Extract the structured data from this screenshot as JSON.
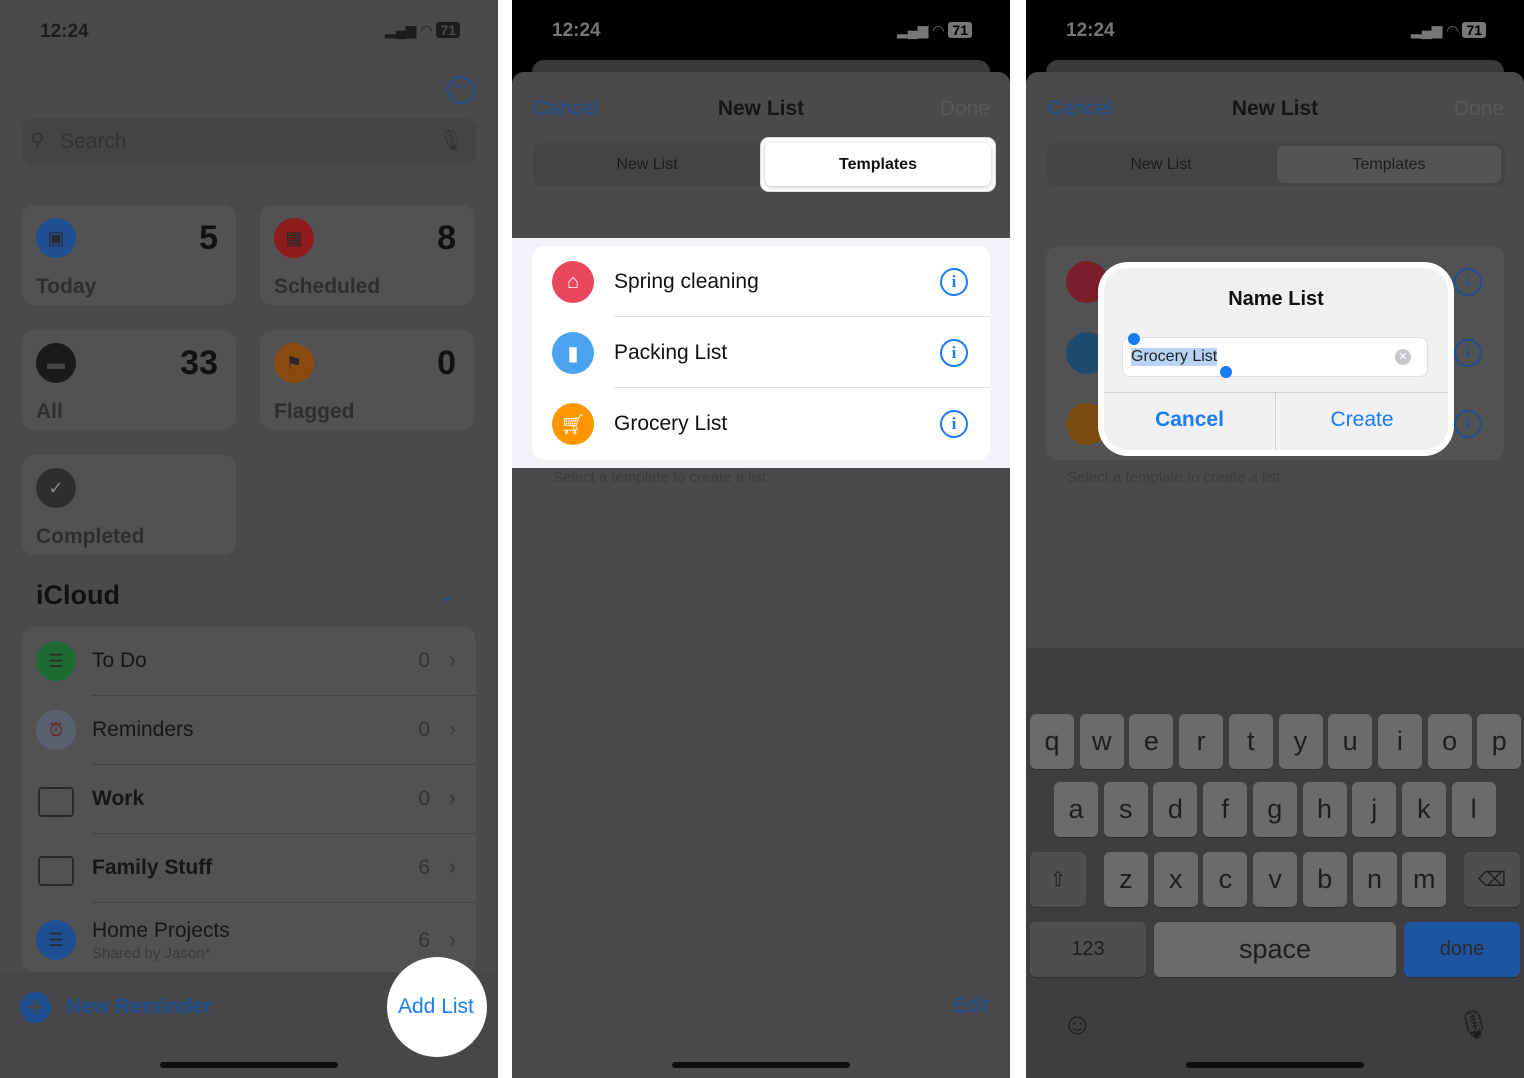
{
  "status": {
    "time": "12:24",
    "battery": "71"
  },
  "panel1": {
    "search_placeholder": "Search",
    "cards": [
      {
        "label": "Today",
        "count": "5",
        "color": "#1d4f92"
      },
      {
        "label": "Scheduled",
        "count": "8",
        "color": "#8e1c1c"
      },
      {
        "label": "All",
        "count": "33",
        "color": "#1a1a1c"
      },
      {
        "label": "Flagged",
        "count": "0",
        "color": "#8a4a10"
      },
      {
        "label": "Completed",
        "count": "",
        "color": "#3a3a3c"
      }
    ],
    "section_title": "iCloud",
    "lists": [
      {
        "name": "To Do",
        "count": "0",
        "icon": "list-icon",
        "color": "#1e6b34"
      },
      {
        "name": "Reminders",
        "count": "0",
        "icon": "alarm-clock-icon",
        "color": "#5a6070"
      },
      {
        "name": "Work",
        "count": "0",
        "icon": "stack-icon",
        "color": ""
      },
      {
        "name": "Family Stuff",
        "count": "6",
        "icon": "stack-icon",
        "color": ""
      },
      {
        "name": "Home Projects",
        "subtitle": "Shared by Jason*",
        "count": "6",
        "icon": "list-icon",
        "color": "#1d4f92"
      }
    ],
    "new_reminder": "New Reminder",
    "add_list": "Add List"
  },
  "sheet": {
    "cancel": "Cancel",
    "title": "New List",
    "done": "Done",
    "segments": [
      "New List",
      "Templates"
    ],
    "templates": [
      {
        "name": "Spring cleaning",
        "icon": "house-icon",
        "color": "#e8475f"
      },
      {
        "name": "Packing List",
        "icon": "bag-icon",
        "color": "#4aa3ee"
      },
      {
        "name": "Grocery List",
        "icon": "cart-icon",
        "color": "#ff9500"
      }
    ],
    "footer": "Select a template to create a list.",
    "edit": "Edit"
  },
  "dialog": {
    "title": "Name List",
    "value": "Grocery List",
    "cancel": "Cancel",
    "create": "Create"
  },
  "keyboard": {
    "row1": [
      "q",
      "w",
      "e",
      "r",
      "t",
      "y",
      "u",
      "i",
      "o",
      "p"
    ],
    "row2": [
      "a",
      "s",
      "d",
      "f",
      "g",
      "h",
      "j",
      "k",
      "l"
    ],
    "row3": [
      "z",
      "x",
      "c",
      "v",
      "b",
      "n",
      "m"
    ],
    "numbers": "123",
    "space": "space",
    "done": "done"
  }
}
